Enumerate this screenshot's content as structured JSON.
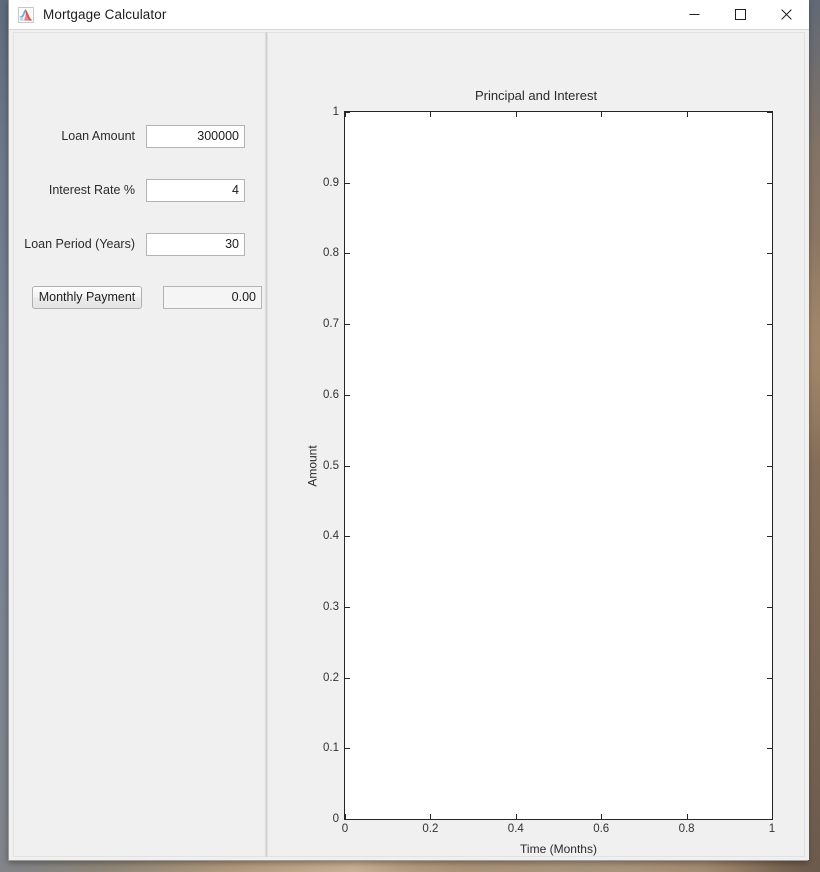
{
  "window": {
    "title": "Mortgage Calculator",
    "icon": "matlab-logo-icon",
    "controls": {
      "minimize": "—",
      "maximize": "□",
      "close": "✕"
    }
  },
  "form": {
    "fields": [
      {
        "label": "Loan Amount",
        "value": "300000",
        "placeholder": ""
      },
      {
        "label": "Interest Rate %",
        "value": "4",
        "placeholder": ""
      },
      {
        "label": "Loan Period (Years)",
        "value": "30",
        "placeholder": ""
      }
    ],
    "action": {
      "button_label": "Monthly Payment",
      "result_value": "0.00"
    }
  },
  "chart_data": {
    "type": "line",
    "title": "Principal and Interest",
    "xlabel": "Time (Months)",
    "ylabel": "Amount",
    "xlim": [
      0,
      1
    ],
    "ylim": [
      0,
      1
    ],
    "grid": false,
    "legend": null,
    "series": [],
    "x_ticks": [
      0,
      0.2,
      0.4,
      0.6,
      0.8,
      1
    ],
    "x_tick_labels": [
      "0",
      "0.2",
      "0.4",
      "0.6",
      "0.8",
      "1"
    ],
    "y_ticks": [
      0,
      0.1,
      0.2,
      0.3,
      0.4,
      0.5,
      0.6,
      0.7,
      0.8,
      0.9,
      1
    ],
    "y_tick_labels": [
      "0",
      "0.1",
      "0.2",
      "0.3",
      "0.4",
      "0.5",
      "0.6",
      "0.7",
      "0.8",
      "0.9",
      "1"
    ]
  },
  "colors": {
    "window_background": "#f0f0f0",
    "titlebar_background": "#ffffff",
    "plot_background": "#ffffff",
    "axis": "#262626",
    "text": "#2b2b2b",
    "input_border": "#b4b4b4"
  }
}
